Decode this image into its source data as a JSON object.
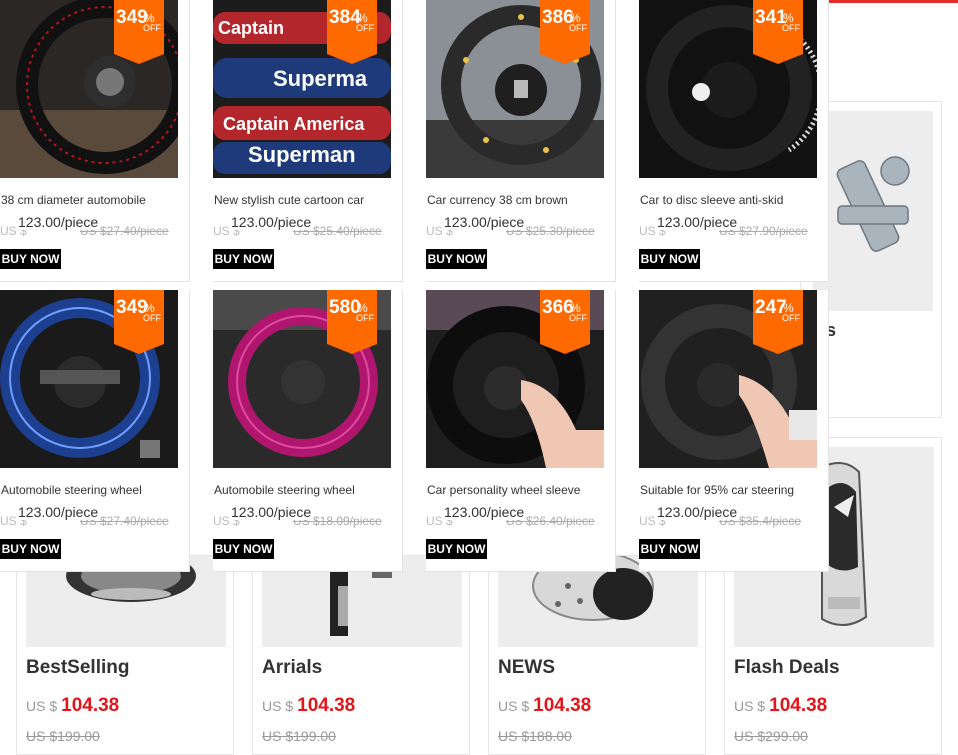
{
  "popup": {
    "products": [
      {
        "badge": "349",
        "title": "38 cm diameter automobile",
        "currency": "US $",
        "price": "123.00/piece",
        "old_price": "US $27.40/piece",
        "buy": "BUY NOW"
      },
      {
        "badge": "384",
        "title": "New stylish cute cartoon car",
        "currency": "US $",
        "price": "123.00/piece",
        "old_price": "US $25.40/piece",
        "buy": "BUY NOW"
      },
      {
        "badge": "386",
        "title": "Car currency 38 cm brown",
        "currency": "US $",
        "price": "123.00/piece",
        "old_price": "US $25.30/piece",
        "buy": "BUY NOW"
      },
      {
        "badge": "341",
        "title": "Car to disc sleeve anti-skid",
        "currency": "US $",
        "price": "123.00/piece",
        "old_price": "US $27.90/piece",
        "buy": "BUY NOW"
      },
      {
        "badge": "349",
        "title": "Automobile steering wheel",
        "currency": "US $",
        "price": "123.00/piece",
        "old_price": "US $27.40/piece",
        "buy": "BUY NOW"
      },
      {
        "badge": "580",
        "title": "Automobile steering wheel",
        "currency": "US $",
        "price": "123.00/piece",
        "old_price": "US $18.09/piece",
        "buy": "BUY NOW"
      },
      {
        "badge": "366",
        "title": "Car personality wheel sleeve",
        "currency": "US $",
        "price": "123.00/piece",
        "old_price": "US $26.40/piece",
        "buy": "BUY NOW"
      },
      {
        "badge": "247",
        "title": "Suitable for 95% car steering",
        "currency": "US $",
        "price": "123.00/piece",
        "old_price": "US $35.4/piece",
        "buy": "BUY NOW"
      }
    ],
    "badge_percent": "%",
    "badge_off": "OFF"
  },
  "background": {
    "peek_text": "s",
    "cards": [
      {
        "title": "BestSelling",
        "currency": "US $",
        "price": "104.38",
        "old_price": "US $199.00"
      },
      {
        "title": "Arrials",
        "currency": "US $",
        "price": "104.38",
        "old_price": "US $199.00"
      },
      {
        "title": "NEWS",
        "currency": "US $",
        "price": "104.38",
        "old_price": "US $188.00"
      },
      {
        "title": "Flash Deals",
        "currency": "US $",
        "price": "104.38",
        "old_price": "US $299.00"
      }
    ]
  },
  "colors": {
    "badge": "#ff6a00",
    "price_red": "#e4151a",
    "accent_red": "#e62e2e",
    "buy_button": "#000000"
  },
  "icons": [
    "chevron-right-icon"
  ]
}
